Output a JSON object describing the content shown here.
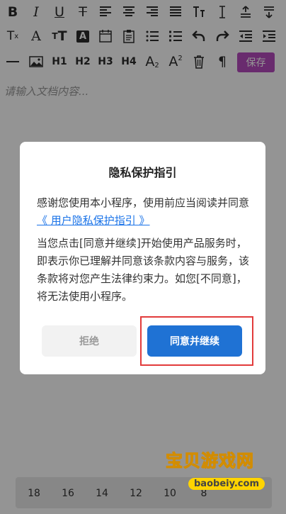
{
  "toolbar": {
    "row1": [
      "bold-icon",
      "italic-icon",
      "underline-icon",
      "strikethrough-icon",
      "align-left-icon",
      "align-center-icon",
      "align-right-icon",
      "align-justify-icon",
      "line-height-icon",
      "text-indent-icon",
      "text-top-icon",
      "text-bottom-icon"
    ],
    "row2": [
      "clear-format-icon",
      "font-icon",
      "font-size-icon",
      "text-color-icon",
      "date-icon",
      "clipboard-icon",
      "ordered-list-icon",
      "unordered-list-icon",
      "undo-icon",
      "redo-icon",
      "outdent-icon",
      "indent-icon"
    ],
    "h1": "H1",
    "h2": "H2",
    "h3": "H3",
    "h4": "H4",
    "save_label": "保存"
  },
  "editor": {
    "placeholder": "请输入文档内容..."
  },
  "bottom": {
    "sizes": [
      "18",
      "16",
      "14",
      "12",
      "10",
      "8"
    ]
  },
  "dialog": {
    "title": "隐私保护指引",
    "p1_prefix": "感谢您使用本小程序，使用前应当阅读并同意",
    "p1_link": "《 用户隐私保护指引 》",
    "p2": "当您点击[同意并继续]开始使用产品服务时，即表示你已理解并同意该条款内容与服务，该条款将对您产生法律约束力。如您[不同意]，将无法使用小程序。",
    "reject_label": "拒绝",
    "agree_label": "同意并继续"
  },
  "watermark": {
    "text": "宝贝游戏网",
    "url": "baobeiy.com"
  },
  "colors": {
    "accent": "#1f72d4",
    "save": "#b64bbd",
    "highlight": "#e23b3b"
  }
}
